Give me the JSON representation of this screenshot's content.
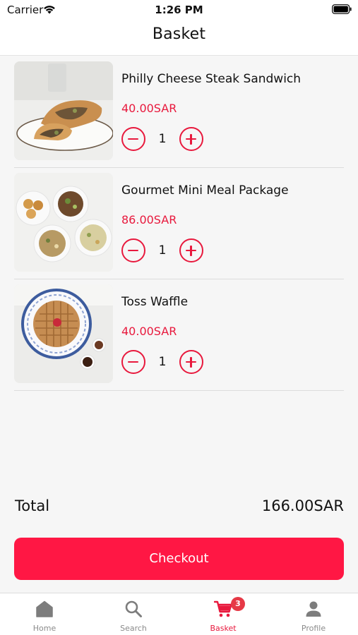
{
  "status_bar": {
    "carrier": "Carrier",
    "time": "1:26 PM"
  },
  "nav": {
    "title": "Basket"
  },
  "items": [
    {
      "name": "Philly Cheese Steak Sandwich",
      "price": "40.00SAR",
      "quantity": "1",
      "image": "sandwich-photo"
    },
    {
      "name": "Gourmet Mini Meal Package",
      "price": "86.00SAR",
      "quantity": "1",
      "image": "meal-bowls-photo"
    },
    {
      "name": "Toss Waffle",
      "price": "40.00SAR",
      "quantity": "1",
      "image": "waffle-photo"
    }
  ],
  "total": {
    "label": "Total",
    "value": "166.00SAR"
  },
  "checkout": {
    "label": "Checkout"
  },
  "tabs": [
    {
      "label": "Home",
      "icon": "home-icon"
    },
    {
      "label": "Search",
      "icon": "search-icon"
    },
    {
      "label": "Basket",
      "icon": "cart-icon",
      "badge": "3",
      "active": true
    },
    {
      "label": "Profile",
      "icon": "profile-icon"
    }
  ],
  "colors": {
    "accent": "#e8193d",
    "button": "#ff1744",
    "badge": "#e63946",
    "inactive": "#8a8a8a"
  }
}
